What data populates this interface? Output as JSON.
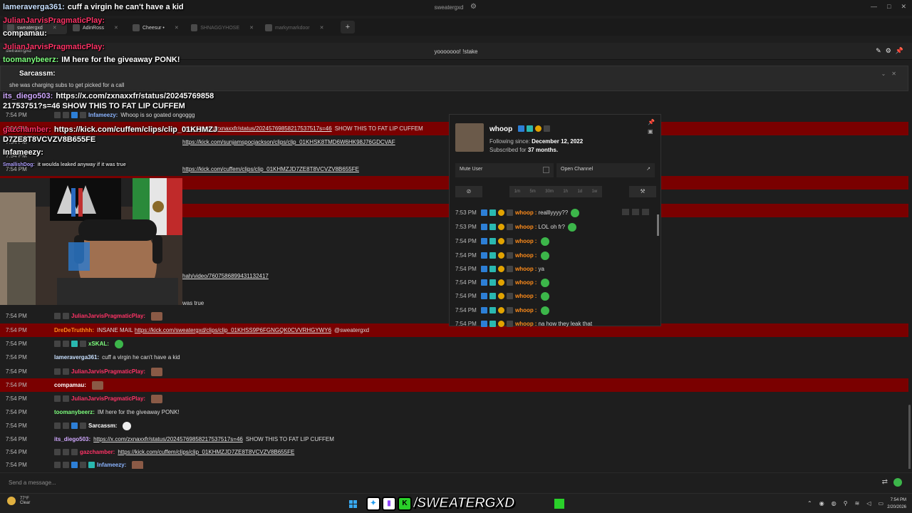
{
  "window": {
    "title": "sweatergxd",
    "controls": [
      "—",
      "□",
      "✕"
    ]
  },
  "tabs": [
    {
      "label": "sweatergxd",
      "active": true
    },
    {
      "label": "AdinRoss",
      "active": false
    },
    {
      "label": "Cheesur •",
      "active": false
    },
    {
      "label": "SHNAGGYHOSE",
      "active": false
    },
    {
      "label": "markymarkdoor",
      "active": false
    }
  ],
  "tab_add": "+",
  "channel": {
    "name": "sweatergxd",
    "title": "yooooooo! !stake"
  },
  "overlay_captions": [
    {
      "user": "lameraverga361:",
      "text": "cuff a virgin he can't have a kid",
      "color": "#c8e0ff"
    },
    {
      "user": "JulianJarvisPragmaticPlay:",
      "text": "",
      "color": "#ff3366"
    },
    {
      "user": "compamau:",
      "text": "",
      "color": "#ffffff"
    },
    {
      "user": "JulianJarvisPragmaticPlay:",
      "text": "",
      "color": "#ff3366"
    },
    {
      "user": "toomanybeerz:",
      "text": "IM here for the giveaway PONK!",
      "color": "#7dff7d"
    },
    {
      "user": "Sarcassm:",
      "text": "",
      "color": "#ffffff"
    },
    {
      "user": "its_diego503:",
      "text": "https://x.com/zxnaxxfr/status/20245769858",
      "color": "#d0a8ff"
    },
    {
      "user": "",
      "text": "21753751?s=46 SHOW THIS TO FAT LIP CUFFEM",
      "color": "#ffffff"
    },
    {
      "user": "gazchamber:",
      "text": "https://kick.com/cuffem/clips/clip_01KHMZJ",
      "color": "#ff3366"
    },
    {
      "user": "",
      "text": "D7ZE8T8VCVZV8B655FE",
      "color": "#ffffff"
    },
    {
      "user": "Infameezy:",
      "text": "",
      "color": "#ffffff"
    },
    {
      "user": "SmallishDog:",
      "text": "it woulda leaked anyway if it was true",
      "color": "#b0a0ff"
    }
  ],
  "reply": {
    "user": "Sarcassm:",
    "text": "she was charging subs to get picked for a call"
  },
  "messages": [
    {
      "time": "7:54 PM",
      "hl": false,
      "badges": [
        "dark",
        "dark",
        "blue",
        "dark"
      ],
      "user": "Infameezy:",
      "color": "#8ab4ff",
      "text": "Whoop is so goated ongoggg"
    },
    {
      "time": "7:54 PM",
      "hl": true,
      "badges": [],
      "user": "",
      "color": "#ffffff",
      "text": "",
      "link": "https://x.com/zxnaxxfr/status/20245769858217537517s=46",
      "after": "SHOW THIS TO FAT LIP CUFFEM"
    },
    {
      "time": "7:54 PM",
      "hl": false,
      "badges": [],
      "user": "",
      "color": "#ffffff",
      "text": "",
      "link": "https://kick.com/sunjamspocjackson/clips/clip_01KHSK8TMD6W6HK98J76GDCVAF",
      "after": ""
    },
    {
      "time": "7:54 PM",
      "hl": false,
      "badges": [],
      "user": "",
      "color": "#ffffff",
      "text": "",
      "link": "",
      "after": ""
    },
    {
      "time": "7:54 PM",
      "hl": false,
      "badges": [],
      "user": "",
      "color": "#ffffff",
      "text": "",
      "link": "https://kick.com/cuffem/clips/clip_01KHMZJD7ZE8T8VCVZV8B655FE",
      "after": ""
    },
    {
      "time": "7:54 PM",
      "hl": true,
      "badges": [],
      "user": "",
      "color": "#ffffff",
      "text": "",
      "link": "",
      "after": ""
    },
    {
      "time": "7:54 PM",
      "hl": false,
      "badges": [],
      "user": "",
      "color": "#ffffff",
      "text": "",
      "link": "",
      "after": ""
    },
    {
      "time": "7:54 PM",
      "hl": true,
      "badges": [],
      "user": "",
      "color": "#ffffff",
      "text": "",
      "link": "",
      "after": ""
    },
    {
      "time": "7:54 PM",
      "hl": false,
      "badges": [],
      "user": "",
      "color": "#ffffff",
      "text": "",
      "link": "",
      "after": ""
    },
    {
      "time": "7:54 PM",
      "hl": false,
      "badges": [],
      "user": "",
      "color": "#ffffff",
      "text": "",
      "link": "hah/video/7607586899431132417",
      "after": ""
    },
    {
      "time": "7:54 PM",
      "hl": false,
      "badges": [],
      "user": "",
      "color": "#ffffff",
      "text": "",
      "link": "",
      "after": ""
    },
    {
      "time": "7:54 PM",
      "hl": false,
      "badges": [],
      "user": "",
      "color": "#ffffff",
      "text": "was true",
      "link": "",
      "after": ""
    },
    {
      "time": "7:54 PM",
      "hl": false,
      "badges": [
        "dark",
        "dark"
      ],
      "user": "JulianJarvisPragmaticPlay:",
      "color": "#ff3366",
      "text": "",
      "emote": "pic"
    },
    {
      "time": "7:54 PM",
      "hl": true,
      "badges": [],
      "user": "DreDeTruthhh:",
      "color": "#ff8c1a",
      "text": "INSANE MAIL",
      "link": "https://kick.com/sweatergxd/clips/clip_01KHSS9P6FGNGQK0CVVRHGYWY6",
      "after": "@sweatergxd"
    },
    {
      "time": "7:54 PM",
      "hl": false,
      "badges": [
        "dark",
        "dark",
        "teal",
        "dark"
      ],
      "user": "xSKAL:",
      "color": "#7dff7d",
      "text": "",
      "emote": "green"
    },
    {
      "time": "7:54 PM",
      "hl": false,
      "badges": [],
      "user": "lameraverga361:",
      "color": "#c8e0ff",
      "text": "cuff a virgin he can't have a kid"
    },
    {
      "time": "7:54 PM",
      "hl": false,
      "badges": [
        "dark",
        "dark"
      ],
      "user": "JulianJarvisPragmaticPlay:",
      "color": "#ff3366",
      "text": "",
      "emote": "pic"
    },
    {
      "time": "7:54 PM",
      "hl": true,
      "badges": [],
      "user": "compamau:",
      "color": "#ffffff",
      "text": "",
      "emote": "pic"
    },
    {
      "time": "7:54 PM",
      "hl": false,
      "badges": [
        "dark",
        "dark"
      ],
      "user": "JulianJarvisPragmaticPlay:",
      "color": "#ff3366",
      "text": "",
      "emote": "pic"
    },
    {
      "time": "7:54 PM",
      "hl": false,
      "badges": [],
      "user": "toomanybeerz:",
      "color": "#7dff7d",
      "text": "IM here for the giveaway PONK!"
    },
    {
      "time": "7:54 PM",
      "hl": false,
      "badges": [
        "dark",
        "dark",
        "blue",
        "dark"
      ],
      "user": "Sarcassm:",
      "color": "#ffffff",
      "text": "",
      "emote": "white"
    },
    {
      "time": "7:54 PM",
      "hl": false,
      "badges": [],
      "user": "its_diego503:",
      "color": "#d0a8ff",
      "text": "",
      "link": "https://x.com/zxnaxxfr/status/20245769858217537517s=46",
      "after": "SHOW THIS TO FAT LIP CUFFEM"
    },
    {
      "time": "7:54 PM",
      "hl": false,
      "badges": [
        "dark",
        "dark",
        "dark"
      ],
      "user": "gazchamber:",
      "color": "#ff3366",
      "text": "",
      "link": "https://kick.com/cuffem/clips/clip_01KHMZJD7ZE8T8VCVZV8B655FE",
      "after": ""
    },
    {
      "time": "7:54 PM",
      "hl": false,
      "badges": [
        "dark",
        "dark",
        "blue",
        "dark",
        "teal"
      ],
      "user": "Infameezy:",
      "color": "#8ab4ff",
      "text": "",
      "emote": "pic"
    }
  ],
  "usercard": {
    "username": "whoop",
    "following_label": "Following since:",
    "following_value": "December 12, 2022",
    "sub_label": "Subscribed for",
    "sub_value": "37 months.",
    "mute_label": "Mute User",
    "open_label": "Open Channel",
    "timeouts": [
      "1m",
      "5m",
      "30m",
      "1h",
      "1d",
      "1w"
    ],
    "history": [
      {
        "time": "7:53 PM",
        "text": "realllyyyy??",
        "emote": true
      },
      {
        "time": "7:53 PM",
        "text": "LOL oh fr?",
        "emote": true
      },
      {
        "time": "7:54 PM",
        "text": "",
        "emote": true
      },
      {
        "time": "7:54 PM",
        "text": "",
        "emote": true
      },
      {
        "time": "7:54 PM",
        "text": "ya",
        "emote": false
      },
      {
        "time": "7:54 PM",
        "text": "",
        "emote": true
      },
      {
        "time": "7:54 PM",
        "text": "",
        "emote": true
      },
      {
        "time": "7:54 PM",
        "text": "",
        "emote": true
      },
      {
        "time": "7:54 PM",
        "text": "na how they leak that",
        "emote": false
      }
    ]
  },
  "input": {
    "placeholder": "Send a message..."
  },
  "taskbar": {
    "weather_temp": "77°F",
    "weather_desc": "Clear",
    "brand_text": "/SWEATERGXD",
    "clock_time": "7:54 PM",
    "clock_date": "2/20/2026"
  },
  "colors": {
    "highlight": "#7a0000",
    "accent_green": "#3cb64a",
    "username_orange": "#ff8c1a"
  }
}
